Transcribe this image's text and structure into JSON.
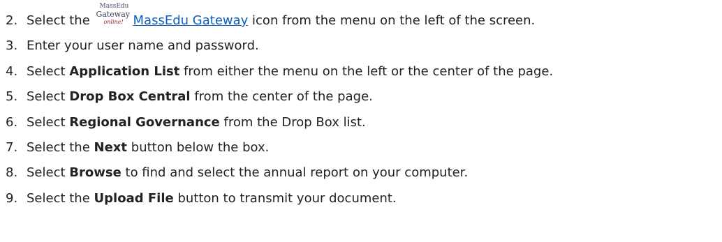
{
  "steps": [
    {
      "number": "2.",
      "parts": {
        "before": "Select the",
        "logo": {
          "line1": "MassEdu",
          "line2": "Gateway",
          "line3": "online!"
        },
        "link": "MassEdu Gateway",
        "after": "icon from the menu on the left of the screen."
      }
    },
    {
      "number": "3.",
      "text": "Enter your user name and password."
    },
    {
      "number": "4.",
      "before": "Select",
      "bold": "Application List",
      "after": "from either the menu on the left or the center of the page."
    },
    {
      "number": "5.",
      "before": "Select",
      "bold": "Drop Box Central",
      "after": "from the center of the page."
    },
    {
      "number": "6.",
      "before": "Select",
      "bold": "Regional Governance",
      "after": "from the Drop Box list."
    },
    {
      "number": "7.",
      "before": "Select the",
      "bold": "Next",
      "after": "button below the box."
    },
    {
      "number": "8.",
      "before": "Select",
      "bold": "Browse",
      "after": "to find and select the annual report on your computer."
    },
    {
      "number": "9.",
      "before": "Select the",
      "bold": "Upload File",
      "after": "button to transmit your document."
    }
  ]
}
